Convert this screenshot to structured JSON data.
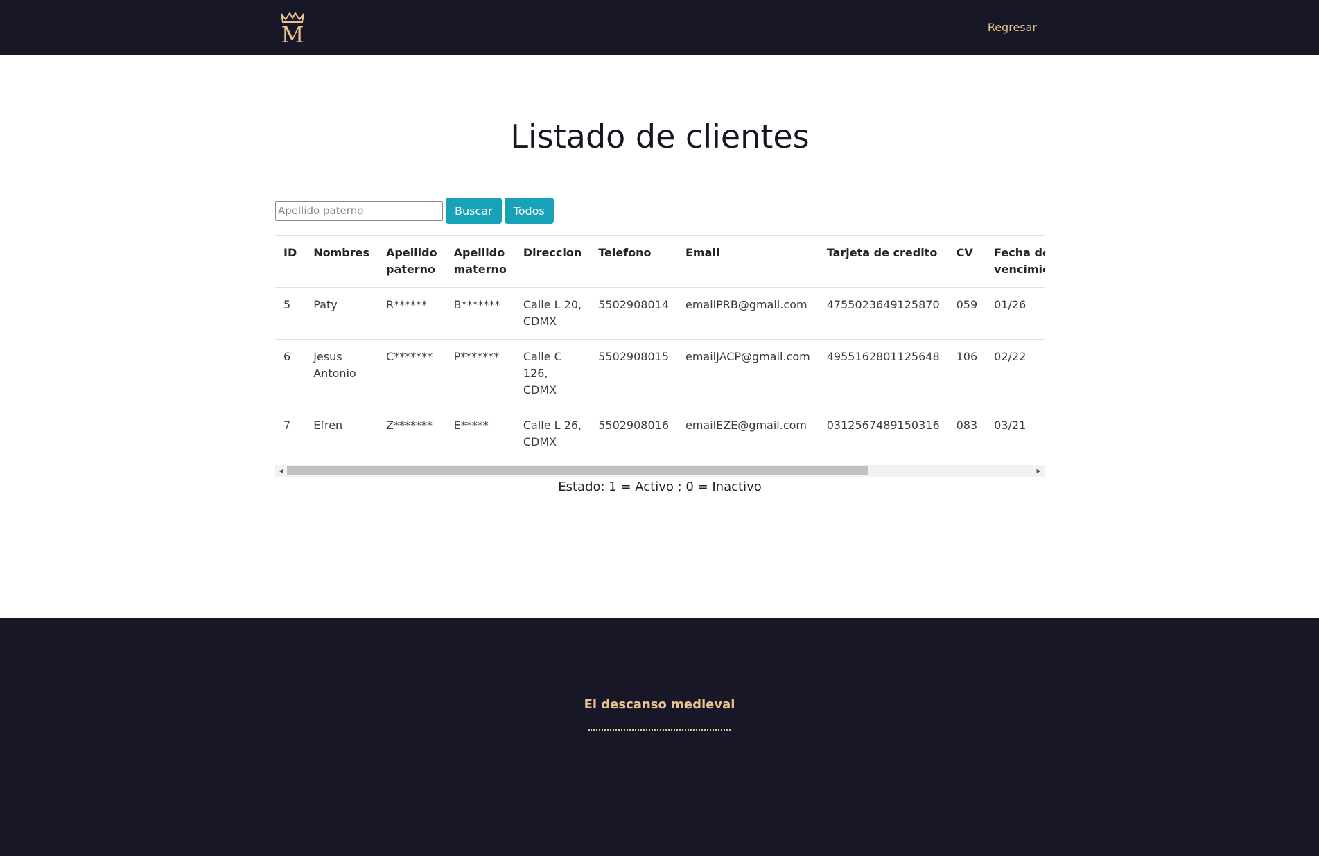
{
  "nav": {
    "back_label": "Regresar",
    "logo": "crown-m-logo"
  },
  "page": {
    "title": "Listado de clientes"
  },
  "search": {
    "placeholder": "Apellido paterno",
    "value": "",
    "search_label": "Buscar",
    "all_label": "Todos"
  },
  "table": {
    "headers": [
      "ID",
      "Nombres",
      "Apellido paterno",
      "Apellido materno",
      "Direccion",
      "Telefono",
      "Email",
      "Tarjeta de credito",
      "CV",
      "Fecha de vencimiento"
    ],
    "rows": [
      [
        "5",
        "Paty",
        "R******",
        "B*******",
        "Calle L 20, CDMX",
        "5502908014",
        "emailPRB@gmail.com",
        "4755023649125870",
        "059",
        "01/26"
      ],
      [
        "6",
        "Jesus Antonio",
        "C*******",
        "P*******",
        "Calle C 126, CDMX",
        "5502908015",
        "emailJACP@gmail.com",
        "4955162801125648",
        "106",
        "02/22"
      ],
      [
        "7",
        "Efren",
        "Z*******",
        "E*****",
        "Calle L 26, CDMX",
        "5502908016",
        "emailEZE@gmail.com",
        "0312567489150316",
        "083",
        "03/21"
      ]
    ],
    "scroll_position": 0.78
  },
  "status_note": "Estado: 1 = Activo ; 0 = Inactivo",
  "footer": {
    "title": "El descanso medieval"
  },
  "colors": {
    "navbar": "#171727",
    "accent_gold": "#e8c38e",
    "button": "#17a2b8"
  }
}
